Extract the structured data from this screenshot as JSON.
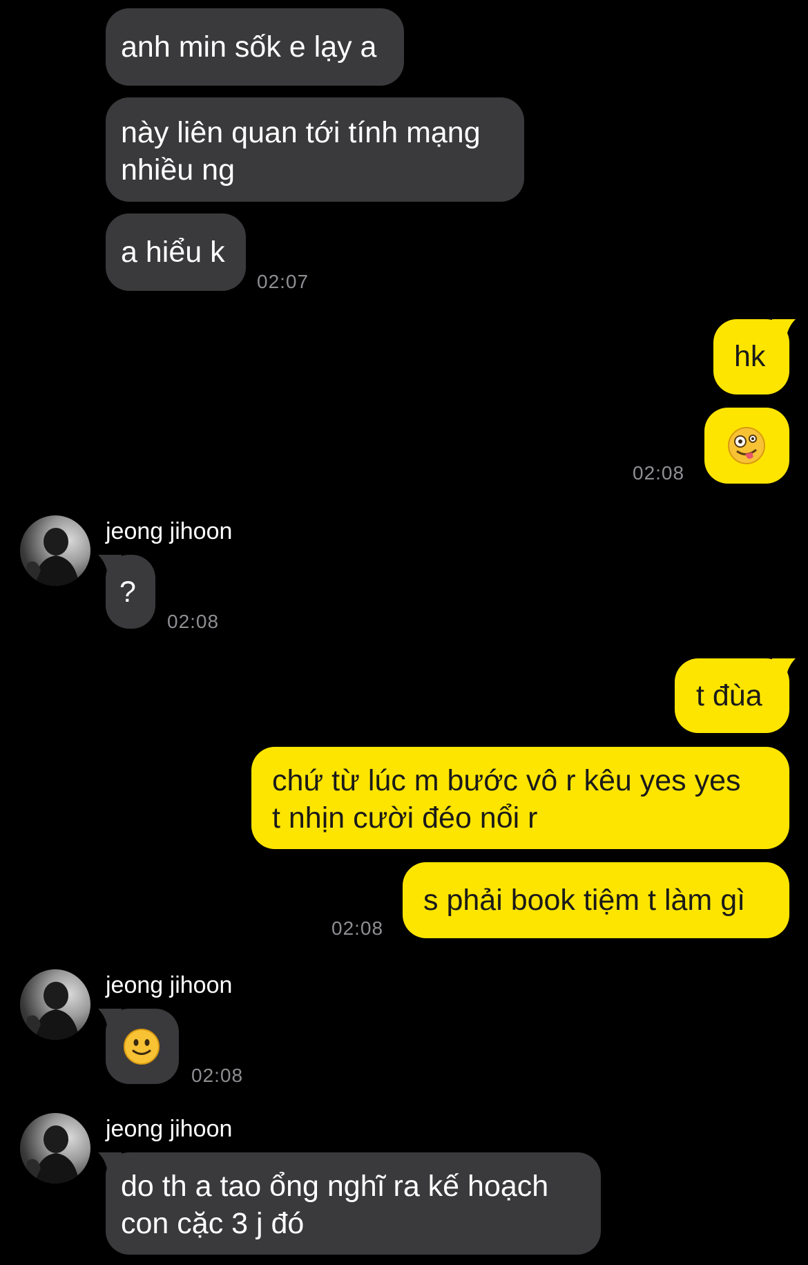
{
  "colors": {
    "background": "#000000",
    "incoming_bubble": "#3a3a3c",
    "outgoing_bubble": "#fee500",
    "timestamp": "#8e8e93"
  },
  "messages": {
    "m1": "anh min sốk e lạy a",
    "m2_line1": "này liên quan tới tính mạng",
    "m2_line2": "nhiều ng",
    "m3": "a hiểu k",
    "ts1": "02:07",
    "m4": "hk",
    "m5_emoji": "zany-face-emoji",
    "ts2": "02:08",
    "sender1": "jeong jihoon",
    "m6": "?",
    "ts3": "02:08",
    "m7": "t đùa",
    "m8_line1": "chứ từ lúc m bước vô r kêu yes yes",
    "m8_line2": "t nhịn cười đéo nổi r",
    "m9": "s phải book tiệm t làm gì",
    "ts4": "02:08",
    "sender2": "jeong jihoon",
    "m10_emoji": "slightly-smiling-face-emoji",
    "ts5": "02:08",
    "sender3": "jeong jihoon",
    "m11_line1": "do th a tao ổng nghĩ ra kế hoạch",
    "m11_line2": "con cặc 3 j đó"
  }
}
